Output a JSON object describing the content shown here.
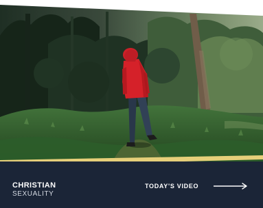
{
  "card": {
    "brand_primary": "CHRISTIAN",
    "brand_secondary": "SEXUALITY",
    "cta_label": "TODAY'S VIDEO",
    "cta_icon": "arrow-right-icon"
  },
  "colors": {
    "footer": "#1b2537",
    "accent": "#e6cf7a",
    "text": "#ffffff",
    "jacket": "#d52129"
  }
}
